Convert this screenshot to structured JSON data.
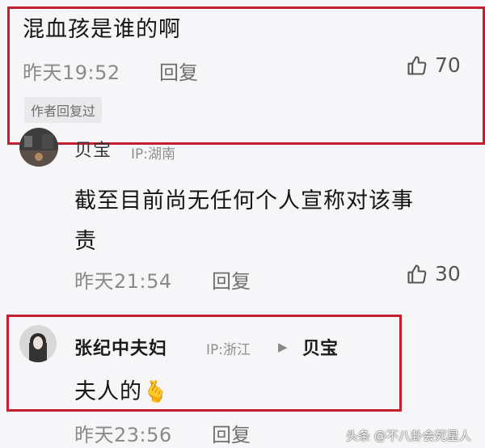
{
  "comment1": {
    "text": "混血孩是谁的啊",
    "time": "昨天19:52",
    "reply_label": "回复",
    "likes": "70",
    "author_badge": "作者回复过"
  },
  "comment2": {
    "username": "贝宝",
    "ip": "IP:湖南",
    "text_line1": "截至目前尚无任何个人宣称对该事",
    "text_line2": "责",
    "time": "昨天21:54",
    "reply_label": "回复",
    "likes": "30"
  },
  "comment3": {
    "username": "张纪中夫妇",
    "ip": "IP:浙江",
    "reply_arrow": "▶",
    "reply_to": "贝宝",
    "text": "夫人的",
    "emoji": "🫰",
    "time": "昨天23:56",
    "reply_label": "回复"
  },
  "watermark": "头条 @不八卦会死星人",
  "colors": {
    "highlight": "#c41f2e",
    "background": "#f6f6f8"
  },
  "icons": [
    "thumbs-up-icon",
    "avatar"
  ]
}
